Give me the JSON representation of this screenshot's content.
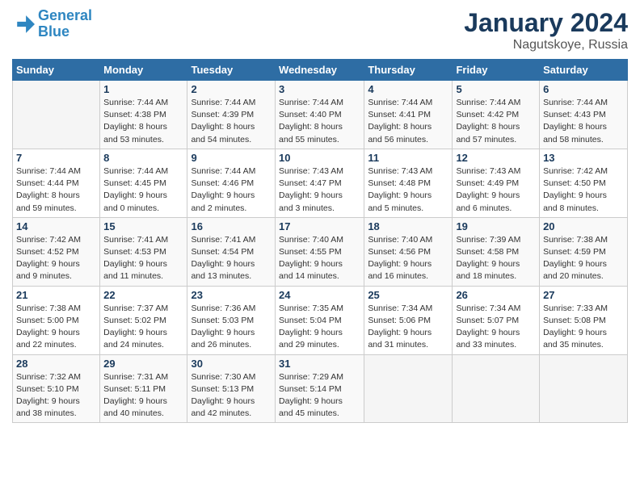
{
  "header": {
    "logo_line1": "General",
    "logo_line2": "Blue",
    "month": "January 2024",
    "location": "Nagutskoye, Russia"
  },
  "days_of_week": [
    "Sunday",
    "Monday",
    "Tuesday",
    "Wednesday",
    "Thursday",
    "Friday",
    "Saturday"
  ],
  "weeks": [
    [
      {
        "day": "",
        "info": ""
      },
      {
        "day": "1",
        "info": "Sunrise: 7:44 AM\nSunset: 4:38 PM\nDaylight: 8 hours\nand 53 minutes."
      },
      {
        "day": "2",
        "info": "Sunrise: 7:44 AM\nSunset: 4:39 PM\nDaylight: 8 hours\nand 54 minutes."
      },
      {
        "day": "3",
        "info": "Sunrise: 7:44 AM\nSunset: 4:40 PM\nDaylight: 8 hours\nand 55 minutes."
      },
      {
        "day": "4",
        "info": "Sunrise: 7:44 AM\nSunset: 4:41 PM\nDaylight: 8 hours\nand 56 minutes."
      },
      {
        "day": "5",
        "info": "Sunrise: 7:44 AM\nSunset: 4:42 PM\nDaylight: 8 hours\nand 57 minutes."
      },
      {
        "day": "6",
        "info": "Sunrise: 7:44 AM\nSunset: 4:43 PM\nDaylight: 8 hours\nand 58 minutes."
      }
    ],
    [
      {
        "day": "7",
        "info": "Sunrise: 7:44 AM\nSunset: 4:44 PM\nDaylight: 8 hours\nand 59 minutes."
      },
      {
        "day": "8",
        "info": "Sunrise: 7:44 AM\nSunset: 4:45 PM\nDaylight: 9 hours\nand 0 minutes."
      },
      {
        "day": "9",
        "info": "Sunrise: 7:44 AM\nSunset: 4:46 PM\nDaylight: 9 hours\nand 2 minutes."
      },
      {
        "day": "10",
        "info": "Sunrise: 7:43 AM\nSunset: 4:47 PM\nDaylight: 9 hours\nand 3 minutes."
      },
      {
        "day": "11",
        "info": "Sunrise: 7:43 AM\nSunset: 4:48 PM\nDaylight: 9 hours\nand 5 minutes."
      },
      {
        "day": "12",
        "info": "Sunrise: 7:43 AM\nSunset: 4:49 PM\nDaylight: 9 hours\nand 6 minutes."
      },
      {
        "day": "13",
        "info": "Sunrise: 7:42 AM\nSunset: 4:50 PM\nDaylight: 9 hours\nand 8 minutes."
      }
    ],
    [
      {
        "day": "14",
        "info": "Sunrise: 7:42 AM\nSunset: 4:52 PM\nDaylight: 9 hours\nand 9 minutes."
      },
      {
        "day": "15",
        "info": "Sunrise: 7:41 AM\nSunset: 4:53 PM\nDaylight: 9 hours\nand 11 minutes."
      },
      {
        "day": "16",
        "info": "Sunrise: 7:41 AM\nSunset: 4:54 PM\nDaylight: 9 hours\nand 13 minutes."
      },
      {
        "day": "17",
        "info": "Sunrise: 7:40 AM\nSunset: 4:55 PM\nDaylight: 9 hours\nand 14 minutes."
      },
      {
        "day": "18",
        "info": "Sunrise: 7:40 AM\nSunset: 4:56 PM\nDaylight: 9 hours\nand 16 minutes."
      },
      {
        "day": "19",
        "info": "Sunrise: 7:39 AM\nSunset: 4:58 PM\nDaylight: 9 hours\nand 18 minutes."
      },
      {
        "day": "20",
        "info": "Sunrise: 7:38 AM\nSunset: 4:59 PM\nDaylight: 9 hours\nand 20 minutes."
      }
    ],
    [
      {
        "day": "21",
        "info": "Sunrise: 7:38 AM\nSunset: 5:00 PM\nDaylight: 9 hours\nand 22 minutes."
      },
      {
        "day": "22",
        "info": "Sunrise: 7:37 AM\nSunset: 5:02 PM\nDaylight: 9 hours\nand 24 minutes."
      },
      {
        "day": "23",
        "info": "Sunrise: 7:36 AM\nSunset: 5:03 PM\nDaylight: 9 hours\nand 26 minutes."
      },
      {
        "day": "24",
        "info": "Sunrise: 7:35 AM\nSunset: 5:04 PM\nDaylight: 9 hours\nand 29 minutes."
      },
      {
        "day": "25",
        "info": "Sunrise: 7:34 AM\nSunset: 5:06 PM\nDaylight: 9 hours\nand 31 minutes."
      },
      {
        "day": "26",
        "info": "Sunrise: 7:34 AM\nSunset: 5:07 PM\nDaylight: 9 hours\nand 33 minutes."
      },
      {
        "day": "27",
        "info": "Sunrise: 7:33 AM\nSunset: 5:08 PM\nDaylight: 9 hours\nand 35 minutes."
      }
    ],
    [
      {
        "day": "28",
        "info": "Sunrise: 7:32 AM\nSunset: 5:10 PM\nDaylight: 9 hours\nand 38 minutes."
      },
      {
        "day": "29",
        "info": "Sunrise: 7:31 AM\nSunset: 5:11 PM\nDaylight: 9 hours\nand 40 minutes."
      },
      {
        "day": "30",
        "info": "Sunrise: 7:30 AM\nSunset: 5:13 PM\nDaylight: 9 hours\nand 42 minutes."
      },
      {
        "day": "31",
        "info": "Sunrise: 7:29 AM\nSunset: 5:14 PM\nDaylight: 9 hours\nand 45 minutes."
      },
      {
        "day": "",
        "info": ""
      },
      {
        "day": "",
        "info": ""
      },
      {
        "day": "",
        "info": ""
      }
    ]
  ]
}
